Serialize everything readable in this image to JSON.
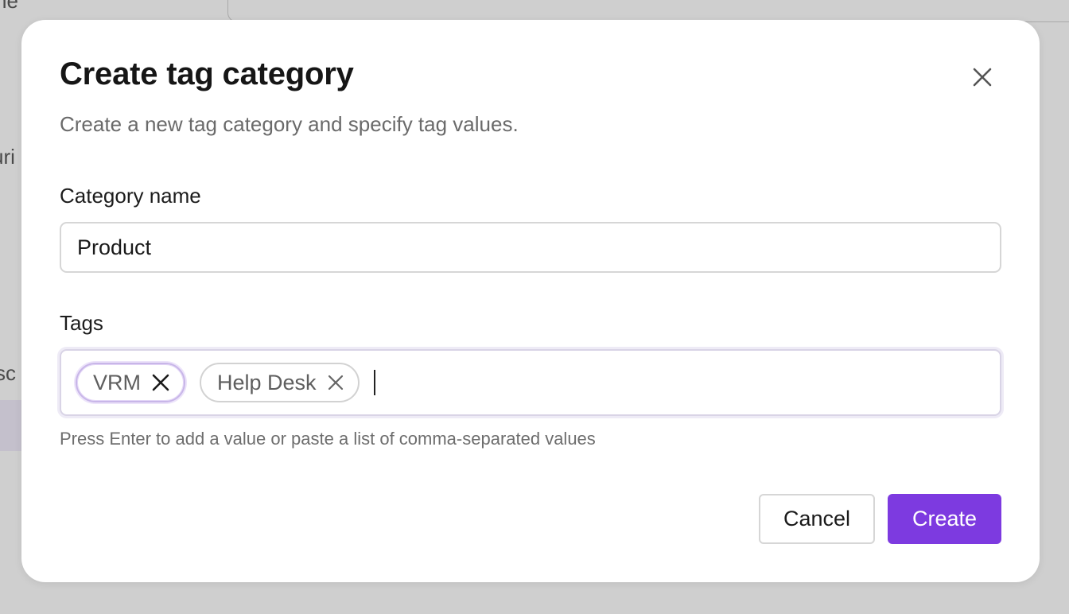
{
  "background": {
    "fragments": [
      "ne",
      "uri",
      "sc"
    ]
  },
  "dialog": {
    "title": "Create tag category",
    "subtitle": "Create a new tag category and specify tag values.",
    "close_icon": "close-icon",
    "category_field": {
      "label": "Category name",
      "value": "Product"
    },
    "tags_field": {
      "label": "Tags",
      "tags": [
        {
          "label": "VRM",
          "focused": true
        },
        {
          "label": "Help Desk",
          "focused": false
        }
      ],
      "helper": "Press Enter to add a value or paste a list of comma-separated values"
    },
    "actions": {
      "cancel_label": "Cancel",
      "create_label": "Create"
    }
  },
  "colors": {
    "accent": "#7d3ae0",
    "overlay": "#cfcfcf"
  }
}
